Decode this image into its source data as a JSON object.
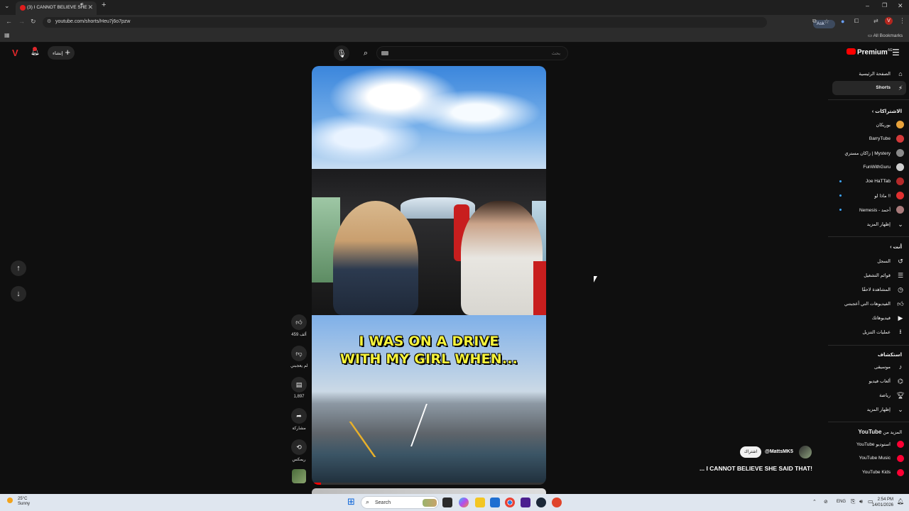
{
  "browser": {
    "tab_title": "(3) I CANNOT BELIEVE SHE",
    "url": "youtube.com/shorts/Heu7j6o7pzw",
    "ask_google": "Ask Google",
    "all_bookmarks": "All Bookmarks"
  },
  "masthead": {
    "create_label": "إنشاء",
    "search_placeholder": "بحث",
    "premium_label": "Premium",
    "premium_sup": "AE"
  },
  "video": {
    "caption_line1": "I WAS ON A DRIVE",
    "caption_line2": "WITH MY GIRL WHEN...",
    "progress": 0.04
  },
  "actions": {
    "like_count": "459 ألف",
    "dislike_label": "لم يعجبني",
    "comments_count": "1,897",
    "share_label": "مشاركة",
    "remix_label": "ريمكس"
  },
  "channel": {
    "handle": "@MattsMK5",
    "subscribe_label": "اشتراك",
    "title": "... I CANNOT BELIEVE SHE SAID THAT!"
  },
  "sidebar": {
    "home": "الصفحة الرئيسية",
    "shorts": "Shorts",
    "subscriptions_head": "الاشتراكات",
    "subscriptions": [
      {
        "label": "بوريكان",
        "color": "#e7a23b",
        "dot": false
      },
      {
        "label": "BarryTube",
        "color": "#d43a3a",
        "dot": false
      },
      {
        "label": "زاكان مستري | Mystery",
        "color": "#8a8a8a",
        "dot": false
      },
      {
        "label": "FunWithGuru",
        "color": "#cfcfcf",
        "dot": false
      },
      {
        "label": "Joe HaTTab",
        "color": "#b52a2a",
        "dot": true
      },
      {
        "label": "ماذا لو !!",
        "color": "#e03030",
        "dot": true
      },
      {
        "label": "Nemesis - أحمد",
        "color": "#a87a7a",
        "dot": true
      }
    ],
    "show_more_1": "إظهار المزيد",
    "you_head": "أنت",
    "you_items": [
      {
        "label": "السجل",
        "icon": "history-icon"
      },
      {
        "label": "قوائم التشغيل",
        "icon": "playlists-icon"
      },
      {
        "label": "المشاهدة لاحقًا",
        "icon": "watch-later-icon"
      },
      {
        "label": "الفيديوهات التي أعجبتني",
        "icon": "liked-videos-icon"
      },
      {
        "label": "فيديوهاتك",
        "icon": "your-videos-icon"
      },
      {
        "label": "عمليات التنزيل",
        "icon": "downloads-icon"
      }
    ],
    "explore_head": "استكشاف",
    "explore_items": [
      {
        "label": "موسيقى",
        "icon": "music-icon"
      },
      {
        "label": "ألعاب فيديو",
        "icon": "gaming-icon"
      },
      {
        "label": "رياضة",
        "icon": "trophy-icon"
      }
    ],
    "show_more_2": "إظهار المزيد",
    "more_head": "المزيد من",
    "more_head_brand": "YouTube",
    "more_items": [
      {
        "label": "YouTube استوديو"
      },
      {
        "label": "YouTube Music"
      },
      {
        "label": "YouTube Kids"
      }
    ]
  },
  "taskbar": {
    "temp": "25°C",
    "weather": "Sunny",
    "search": "Search",
    "lang": "ENG",
    "time": "2:54 PM",
    "date": "14/01/2026"
  }
}
